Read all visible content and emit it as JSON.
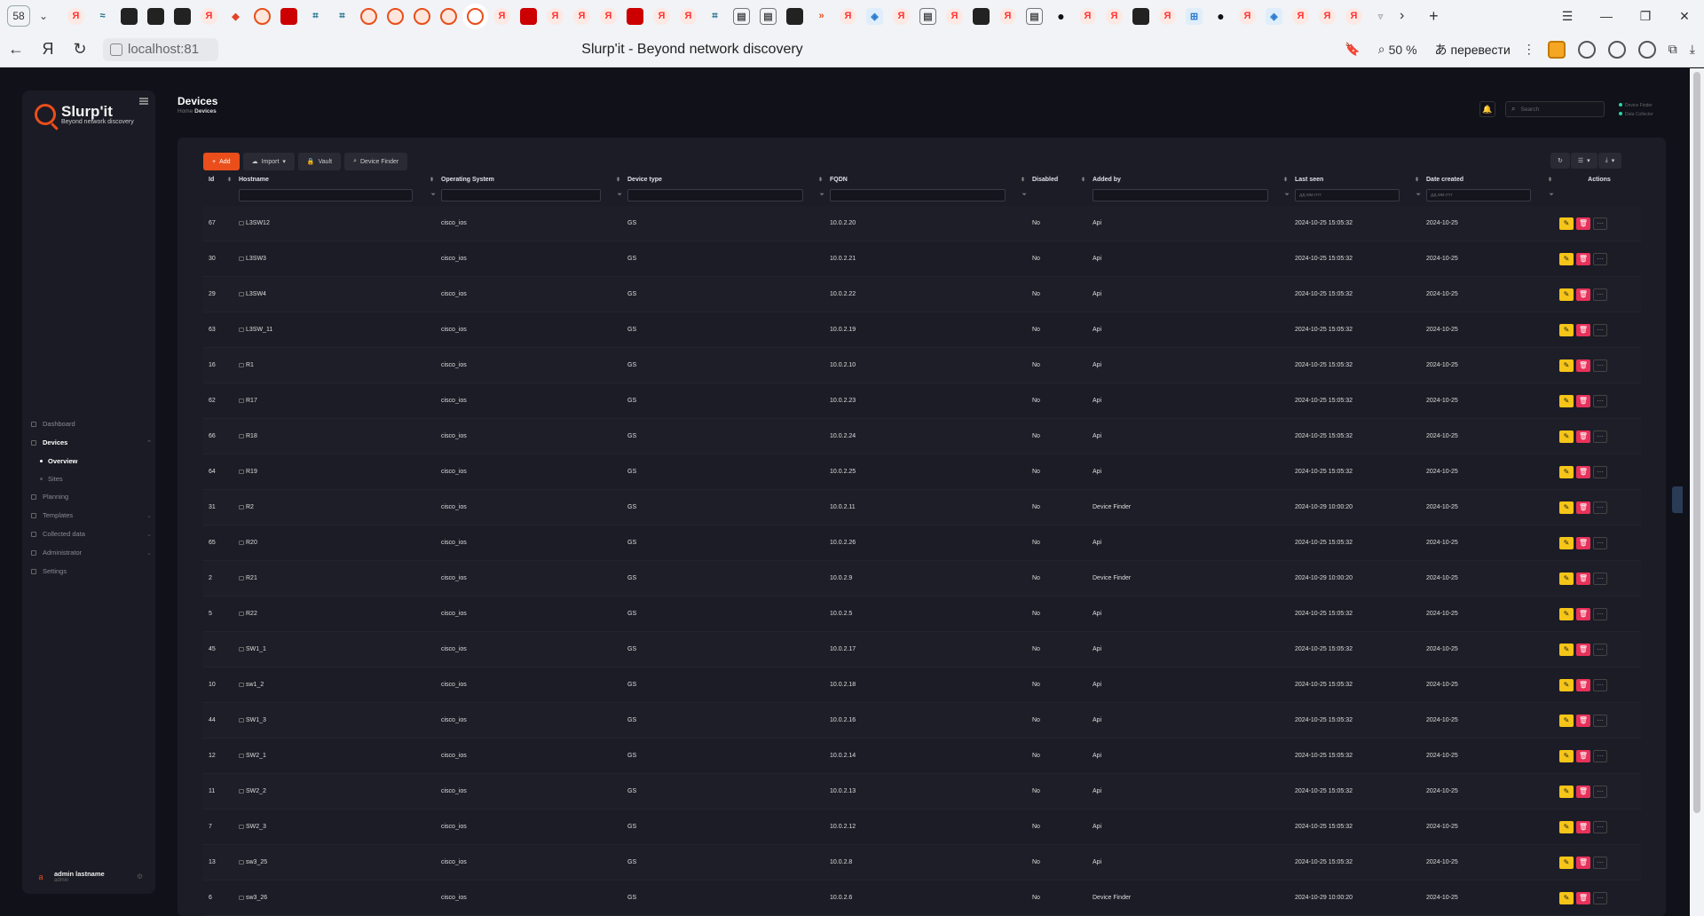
{
  "browser": {
    "tab_count": "58",
    "page_title": "Slurp'it - Beyond network discovery",
    "url": "localhost:81",
    "zoom": "50 %",
    "translate": "перевести"
  },
  "app": {
    "logo_name": "Slurp'it",
    "logo_tag": "Beyond network discovery",
    "nav": {
      "dashboard": "Dashboard",
      "devices": "Devices",
      "overview": "Overview",
      "sites": "Sites",
      "planning": "Planning",
      "templates": "Templates",
      "collected_data": "Collected data",
      "administrator": "Administrator",
      "settings": "Settings"
    },
    "user": {
      "name": "admin lastname",
      "role": "admin",
      "initial": "a"
    },
    "header": {
      "title": "Devices",
      "breadcrumb_home": "Home",
      "breadcrumb_current": "Devices",
      "search_placeholder": "Search",
      "status_1": "Device Finder",
      "status_2": "Data Collector"
    },
    "toolbar": {
      "add": "Add",
      "import": "Import",
      "vault": "Vault",
      "device_finder": "Device Finder"
    },
    "table": {
      "columns": {
        "id": "Id",
        "hostname": "Hostname",
        "os": "Operating System",
        "type": "Device type",
        "fqdn": "FQDN",
        "disabled": "Disabled",
        "added_by": "Added by",
        "last_seen": "Last seen",
        "date_created": "Date created",
        "actions": "Actions"
      },
      "date_placeholder": "дд.мм.гггг",
      "rows": [
        {
          "id": "67",
          "hostname": "L3SW12",
          "os": "cisco_ios",
          "type": "GS",
          "fqdn": "10.0.2.20",
          "disabled": "No",
          "added_by": "Api",
          "last_seen": "2024-10-25 15:05:32",
          "date_created": "2024-10-25"
        },
        {
          "id": "30",
          "hostname": "L3SW3",
          "os": "cisco_ios",
          "type": "GS",
          "fqdn": "10.0.2.21",
          "disabled": "No",
          "added_by": "Api",
          "last_seen": "2024-10-25 15:05:32",
          "date_created": "2024-10-25"
        },
        {
          "id": "29",
          "hostname": "L3SW4",
          "os": "cisco_ios",
          "type": "GS",
          "fqdn": "10.0.2.22",
          "disabled": "No",
          "added_by": "Api",
          "last_seen": "2024-10-25 15:05:32",
          "date_created": "2024-10-25"
        },
        {
          "id": "63",
          "hostname": "L3SW_11",
          "os": "cisco_ios",
          "type": "GS",
          "fqdn": "10.0.2.19",
          "disabled": "No",
          "added_by": "Api",
          "last_seen": "2024-10-25 15:05:32",
          "date_created": "2024-10-25"
        },
        {
          "id": "16",
          "hostname": "R1",
          "os": "cisco_ios",
          "type": "GS",
          "fqdn": "10.0.2.10",
          "disabled": "No",
          "added_by": "Api",
          "last_seen": "2024-10-25 15:05:32",
          "date_created": "2024-10-25"
        },
        {
          "id": "62",
          "hostname": "R17",
          "os": "cisco_ios",
          "type": "GS",
          "fqdn": "10.0.2.23",
          "disabled": "No",
          "added_by": "Api",
          "last_seen": "2024-10-25 15:05:32",
          "date_created": "2024-10-25"
        },
        {
          "id": "66",
          "hostname": "R18",
          "os": "cisco_ios",
          "type": "GS",
          "fqdn": "10.0.2.24",
          "disabled": "No",
          "added_by": "Api",
          "last_seen": "2024-10-25 15:05:32",
          "date_created": "2024-10-25"
        },
        {
          "id": "64",
          "hostname": "R19",
          "os": "cisco_ios",
          "type": "GS",
          "fqdn": "10.0.2.25",
          "disabled": "No",
          "added_by": "Api",
          "last_seen": "2024-10-25 15:05:32",
          "date_created": "2024-10-25"
        },
        {
          "id": "31",
          "hostname": "R2",
          "os": "cisco_ios",
          "type": "GS",
          "fqdn": "10.0.2.11",
          "disabled": "No",
          "added_by": "Device Finder",
          "last_seen": "2024-10-29 10:00:20",
          "date_created": "2024-10-25"
        },
        {
          "id": "65",
          "hostname": "R20",
          "os": "cisco_ios",
          "type": "GS",
          "fqdn": "10.0.2.26",
          "disabled": "No",
          "added_by": "Api",
          "last_seen": "2024-10-25 15:05:32",
          "date_created": "2024-10-25"
        },
        {
          "id": "2",
          "hostname": "R21",
          "os": "cisco_ios",
          "type": "GS",
          "fqdn": "10.0.2.9",
          "disabled": "No",
          "added_by": "Device Finder",
          "last_seen": "2024-10-29 10:00:20",
          "date_created": "2024-10-25"
        },
        {
          "id": "5",
          "hostname": "R22",
          "os": "cisco_ios",
          "type": "GS",
          "fqdn": "10.0.2.5",
          "disabled": "No",
          "added_by": "Api",
          "last_seen": "2024-10-25 15:05:32",
          "date_created": "2024-10-25"
        },
        {
          "id": "45",
          "hostname": "SW1_1",
          "os": "cisco_ios",
          "type": "GS",
          "fqdn": "10.0.2.17",
          "disabled": "No",
          "added_by": "Api",
          "last_seen": "2024-10-25 15:05:32",
          "date_created": "2024-10-25"
        },
        {
          "id": "10",
          "hostname": "sw1_2",
          "os": "cisco_ios",
          "type": "GS",
          "fqdn": "10.0.2.18",
          "disabled": "No",
          "added_by": "Api",
          "last_seen": "2024-10-25 15:05:32",
          "date_created": "2024-10-25"
        },
        {
          "id": "44",
          "hostname": "SW1_3",
          "os": "cisco_ios",
          "type": "GS",
          "fqdn": "10.0.2.16",
          "disabled": "No",
          "added_by": "Api",
          "last_seen": "2024-10-25 15:05:32",
          "date_created": "2024-10-25"
        },
        {
          "id": "12",
          "hostname": "SW2_1",
          "os": "cisco_ios",
          "type": "GS",
          "fqdn": "10.0.2.14",
          "disabled": "No",
          "added_by": "Api",
          "last_seen": "2024-10-25 15:05:32",
          "date_created": "2024-10-25"
        },
        {
          "id": "11",
          "hostname": "SW2_2",
          "os": "cisco_ios",
          "type": "GS",
          "fqdn": "10.0.2.13",
          "disabled": "No",
          "added_by": "Api",
          "last_seen": "2024-10-25 15:05:32",
          "date_created": "2024-10-25"
        },
        {
          "id": "7",
          "hostname": "SW2_3",
          "os": "cisco_ios",
          "type": "GS",
          "fqdn": "10.0.2.12",
          "disabled": "No",
          "added_by": "Api",
          "last_seen": "2024-10-25 15:05:32",
          "date_created": "2024-10-25"
        },
        {
          "id": "13",
          "hostname": "sw3_25",
          "os": "cisco_ios",
          "type": "GS",
          "fqdn": "10.0.2.8",
          "disabled": "No",
          "added_by": "Api",
          "last_seen": "2024-10-25 15:05:32",
          "date_created": "2024-10-25"
        },
        {
          "id": "6",
          "hostname": "sw3_26",
          "os": "cisco_ios",
          "type": "GS",
          "fqdn": "10.0.2.6",
          "disabled": "No",
          "added_by": "Device Finder",
          "last_seen": "2024-10-29 10:00:20",
          "date_created": "2024-10-25"
        }
      ]
    }
  },
  "colors": {
    "accent": "#e94e1b",
    "edit": "#f5c518",
    "delete": "#e8325a",
    "bg": "#11111a",
    "panel": "#1c1c26"
  }
}
